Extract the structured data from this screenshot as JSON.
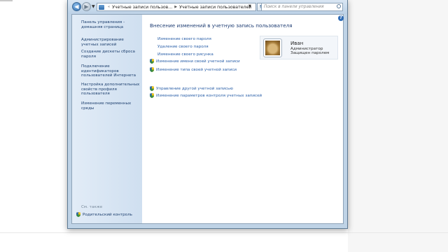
{
  "addressbar": {
    "crumb1": "Учетные записи пользов...",
    "crumb2": "Учетные записи пользователей"
  },
  "search": {
    "placeholder": "Поиск в панели управления"
  },
  "sidebar": {
    "items": [
      {
        "label": "Панель управления - домашняя страница"
      },
      {
        "label": "Администрирование учетных записей"
      },
      {
        "label": "Создание дискеты сброса пароля"
      },
      {
        "label": "Подключение идентификаторов пользователей Интернета"
      },
      {
        "label": "Настройка дополнительных свойств профиля пользователя"
      },
      {
        "label": "Изменение переменных среды"
      }
    ],
    "see_also": "См. также",
    "parental_control": "Родительский контроль"
  },
  "main": {
    "title": "Внесение изменений в учетную запись пользователя",
    "tasks": [
      "Изменение своего пароля",
      "Удаление своего пароля",
      "Изменение своего рисунка"
    ],
    "shield_tasks": [
      "Изменение имени своей учетной записи",
      "Изменение типа своей учетной записи"
    ],
    "admin_tasks": [
      "Управление другой учетной записью",
      "Изменение параметров контроля учетных записей"
    ]
  },
  "user": {
    "name": "Иван",
    "role": "Администратор",
    "status": "Защищен паролем"
  },
  "colors": {
    "link": "#2a5fa8",
    "title": "#1e3d73",
    "sidebar_bg": "#d8e6f4",
    "window_frame": "#bfd3e6"
  }
}
